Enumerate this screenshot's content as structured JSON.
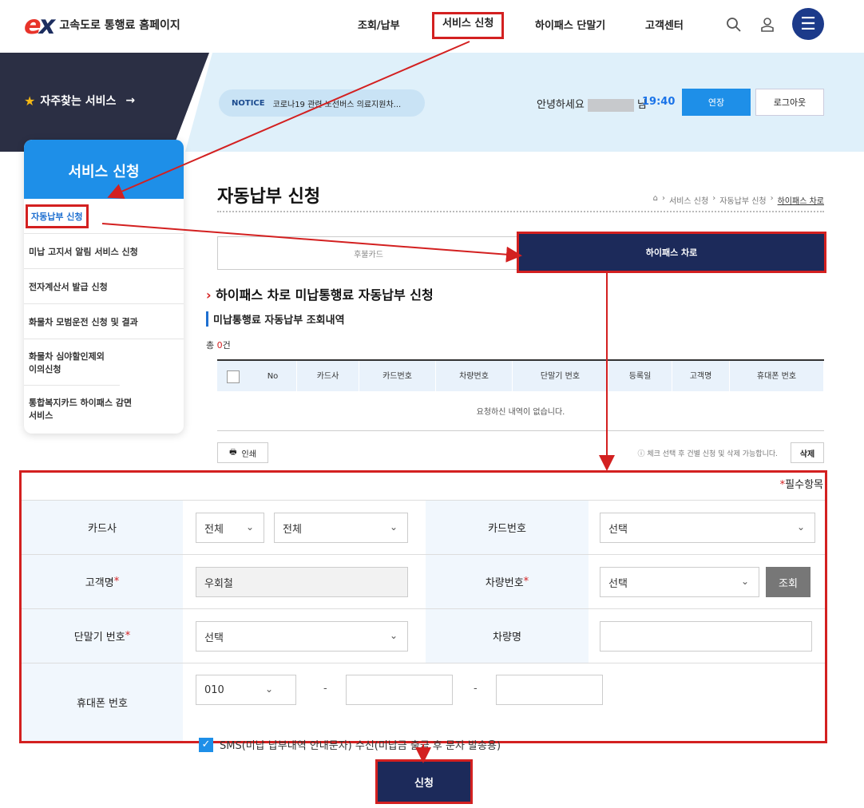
{
  "header": {
    "logo_mark_e": "e",
    "logo_mark_x": "x",
    "logo_text": "고속도로 통행료 홈페이지",
    "nav": [
      "조회/납부",
      "서비스 신청",
      "하이패스 단말기",
      "고객센터"
    ],
    "icons": [
      "search-icon",
      "user-icon",
      "menu-icon"
    ]
  },
  "banner": {
    "favorites": "자주찾는 서비스",
    "favorites_arrow": "→",
    "notice_tag": "NOTICE",
    "notice_text": "코로나19 관련 노선버스 의료지원차...",
    "greeting_prefix": "안녕하세요",
    "greeting_suffix": "님",
    "timer": "19:40",
    "extend": "연장",
    "logout": "로그아웃"
  },
  "sidebar": {
    "title": "서비스 신청",
    "items": [
      {
        "label": "자동납부 신청"
      },
      {
        "label": "미납 고지서 알림 서비스 신청"
      },
      {
        "label": "전자계산서 발급 신청"
      },
      {
        "label": "화물차 모범운전 신청 및 결과"
      },
      {
        "label": "화물차 심야할인제외 이의신청"
      },
      {
        "label": "통합복지카드 하이패스 감면서비스"
      }
    ]
  },
  "main": {
    "page_title": "자동납부 신청",
    "breadcrumb": [
      "서비스 신청",
      "자동납부 신청",
      "하이패스 차로"
    ],
    "tabs": [
      "후불카드",
      "하이패스 차로"
    ],
    "section_title": "하이패스 차로 미납통행료 자동납부 신청",
    "sub_title": "미납통행료 자동납부 조회내역",
    "total_prefix": "총 ",
    "total_count": "0",
    "total_suffix": "건",
    "columns": [
      "No",
      "카드사",
      "카드번호",
      "차량번호",
      "단말기 번호",
      "등록일",
      "고객명",
      "휴대폰 번호"
    ],
    "empty_text": "요청하신 내역이 없습니다.",
    "print": "인쇄",
    "hint": "ⓘ 체크 선택 후 건별 신청 및 삭제 가능합니다.",
    "delete": "삭제"
  },
  "form": {
    "required_note": "필수항목",
    "card_company_label": "카드사",
    "card_company_1": "전체",
    "card_company_2": "전체",
    "card_number_label": "카드번호",
    "card_number": "선택",
    "customer_label": "고객명",
    "customer_name": "우회철",
    "vehicle_label": "차량번호",
    "vehicle_number": "선택",
    "query": "조회",
    "terminal_label": "단말기 번호",
    "terminal_number": "선택",
    "vehicle_name_label": "차량명",
    "vehicle_name": "",
    "phone_label": "휴대폰 번호",
    "phone_prefix": "010",
    "phone_mid": "",
    "phone_last": "",
    "sms_label": "SMS(미납 납부내역 안내문자) 수신(미납금 출금 후 문자 발송용)"
  },
  "submit": "신청",
  "colors": {
    "accent": "#1e8fe8",
    "navy": "#1c2a5a",
    "highlight": "#d32020"
  }
}
